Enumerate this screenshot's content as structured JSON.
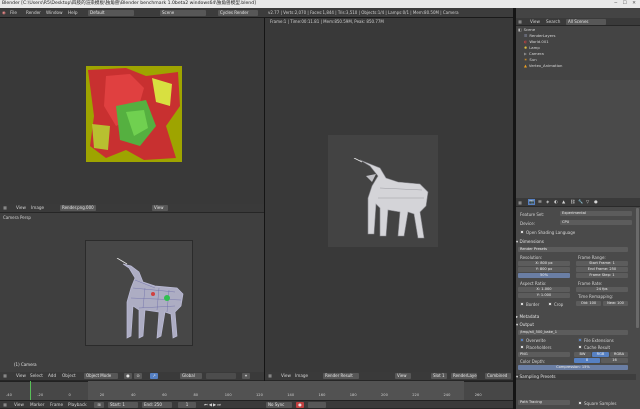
{
  "window": {
    "title": "Blender [C:\\Users\\R5\\Desktop\\四肢的渲染模板\\独角兽\\Blender benchmark 1.0beta2 windows64\\独角兽模型.blend]",
    "controls": "─ ☐ ✕"
  },
  "infobar": {
    "menus": [
      "File",
      "Render",
      "Window",
      "Help"
    ],
    "layout": "Default",
    "scene": "Scene",
    "engine": "Cycles Render",
    "stats": "v2.77 | Verts:2,070 | Faces:1,844 | Tris:3,510 | Objects:1/4 | Lamps:0/1 | Mem:80.50M | Camera"
  },
  "uv_editor": {
    "menus": [
      "View",
      "Image"
    ],
    "image_name": "Render.png.000",
    "view_btn": "View"
  },
  "render_view": {
    "stats": "Frame:1 | Time:00:11.81 | Mem:850.59M, Peak: 850.77M"
  },
  "viewport3d": {
    "label": "Camera Persp",
    "object": "(1) Camera",
    "menus": [
      "View",
      "Select",
      "Add",
      "Object"
    ],
    "mode": "Object Mode",
    "pivot": "Global"
  },
  "image_editor_footer": {
    "menus": [
      "View",
      "Image"
    ],
    "image": "Render Result",
    "view_btn": "View",
    "slot": "Slot 1",
    "layer": "RenderLayer",
    "pass": "Combined"
  },
  "timeline": {
    "menus": [
      "View",
      "Marker",
      "Frame",
      "Playback"
    ],
    "start_label": "Start:",
    "start": "1",
    "end_label": "End:",
    "end": "250",
    "current": "1",
    "sync": "No Sync",
    "ticks": [
      "-40",
      "-20",
      "0",
      "20",
      "40",
      "60",
      "80",
      "100",
      "120",
      "140",
      "160",
      "180",
      "200",
      "220",
      "240",
      "260"
    ]
  },
  "outliner": {
    "view": "View",
    "search": "Search",
    "filter": "All Scenes",
    "items": [
      {
        "label": "Scene",
        "indent": 0,
        "icon": "scene-icon"
      },
      {
        "label": "RenderLayers",
        "indent": 1,
        "icon": "render-layers-icon"
      },
      {
        "label": "World.001",
        "indent": 1,
        "icon": "world-icon"
      },
      {
        "label": "Lamp",
        "indent": 1,
        "icon": "lamp-icon"
      },
      {
        "label": "Camera",
        "indent": 1,
        "icon": "camera-icon"
      },
      {
        "label": "Sun",
        "indent": 1,
        "icon": "sun-icon"
      },
      {
        "label": "Vertex_Animation",
        "indent": 1,
        "icon": "mesh-icon"
      }
    ]
  },
  "properties": {
    "feature_set_label": "Feature Set:",
    "feature_set": "Experimental",
    "device_label": "Device:",
    "device": "CPU",
    "osl_label": "Open Shading Language",
    "dimensions_label": "Dimensions",
    "render_presets": "Render Presets",
    "resolution_label": "Resolution:",
    "res_x": "X:",
    "res_x_val": "800 px",
    "res_y": "Y:",
    "res_y_val": "800 px",
    "res_pct": "50%",
    "frame_range_label": "Frame Range:",
    "start_frame": "Start Frame:",
    "start_frame_val": "1",
    "end_frame": "End Frame:",
    "end_frame_val": "250",
    "frame_step": "Frame Step:",
    "frame_step_val": "1",
    "aspect_label": "Aspect Ratio:",
    "asp_x": "X:",
    "asp_x_val": "1.000",
    "asp_y": "Y:",
    "asp_y_val": "1.000",
    "frame_rate_label": "Frame Rate:",
    "frame_rate": "24 fps",
    "time_remap_label": "Time Remapping:",
    "remap_old": "Old:",
    "remap_old_val": "100",
    "remap_new": "New:",
    "remap_new_val": "100",
    "border_label": "Border",
    "crop_label": "Crop",
    "metadata_label": "Metadata",
    "output_label": "Output",
    "output_path": "/tmp/all_500_bake_1",
    "overwrite_label": "Overwrite",
    "file_ext_label": "File Extensions",
    "placeholders_label": "Placeholders",
    "cache_label": "Cache Result",
    "format": "PNG",
    "bw": "BW",
    "rgb": "RGB",
    "rgba": "RGBA",
    "color_depth_label": "Color Depth:",
    "depth_8": "8",
    "depth_16": "16",
    "compression_label": "Compression:",
    "compression_val": "15%",
    "sampling_presets": "Sampling Presets",
    "path_tracing": "Path Tracing",
    "square_samples": "Square Samples"
  },
  "colors": {
    "accent_blue": "#5680c2",
    "orange_select": "#f0a020",
    "bg_dark": "#393939",
    "bg_panel": "#4a4a4a"
  }
}
